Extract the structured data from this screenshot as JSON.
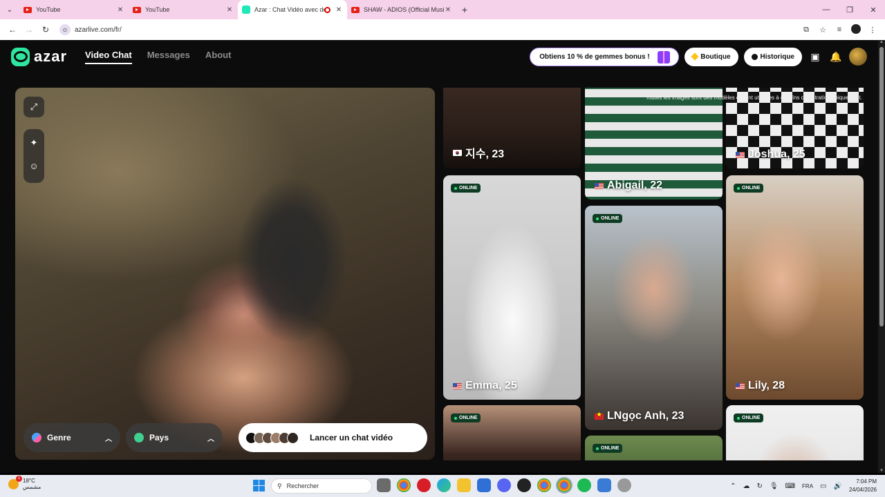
{
  "browser": {
    "tabs": [
      {
        "title": "YouTube",
        "type": "youtube",
        "active": false
      },
      {
        "title": "YouTube",
        "type": "youtube",
        "active": false
      },
      {
        "title": "Azar : Chat Vidéo avec de n",
        "type": "azar",
        "active": true
      },
      {
        "title": "SHAW - ADIOS (Official Music V",
        "type": "youtube",
        "active": false
      }
    ],
    "url": "azarlive.com/fr/"
  },
  "header": {
    "logo_text": "azar",
    "nav": [
      "Video Chat",
      "Messages",
      "About"
    ],
    "promo_label": "Obtiens 10 % de gemmes bonus !",
    "shop_label": "Boutique",
    "history_label": "Historique"
  },
  "video": {
    "genre_label": "Genre",
    "country_label": "Pays",
    "launch_label": "Lancer un chat vidéo"
  },
  "grid": {
    "disclaimer": "Toutes les images sont des modèles et sont utilisées à des fins d'illustration uniquement.",
    "online_label": "ONLINE",
    "cards": [
      {
        "name": "지수, 23",
        "flag": "kr",
        "online": false
      },
      {
        "name": "Abigail, 22",
        "flag": "us",
        "online": false
      },
      {
        "name": "Joshua, 25",
        "flag": "us",
        "online": false
      },
      {
        "name": "Emma, 25",
        "flag": "us",
        "online": true
      },
      {
        "name": "LNgọc Anh, 23",
        "flag": "vn",
        "online": true
      },
      {
        "name": "Lily, 28",
        "flag": "us",
        "online": true
      },
      {
        "name": "",
        "flag": "",
        "online": true
      },
      {
        "name": "",
        "flag": "",
        "online": true
      },
      {
        "name": "",
        "flag": "",
        "online": true
      }
    ]
  },
  "taskbar": {
    "temperature": "18°C",
    "weather_text": "مشمس",
    "search_placeholder": "Rechercher",
    "lang": "FRA",
    "time": "7:04 PM",
    "date": "24/04/2026"
  },
  "colors": {
    "brand": "#2ee6a0",
    "tab_strip": "#f6d1ea",
    "online_badge": "#0f3b24",
    "promo_border": "#b48cff"
  }
}
